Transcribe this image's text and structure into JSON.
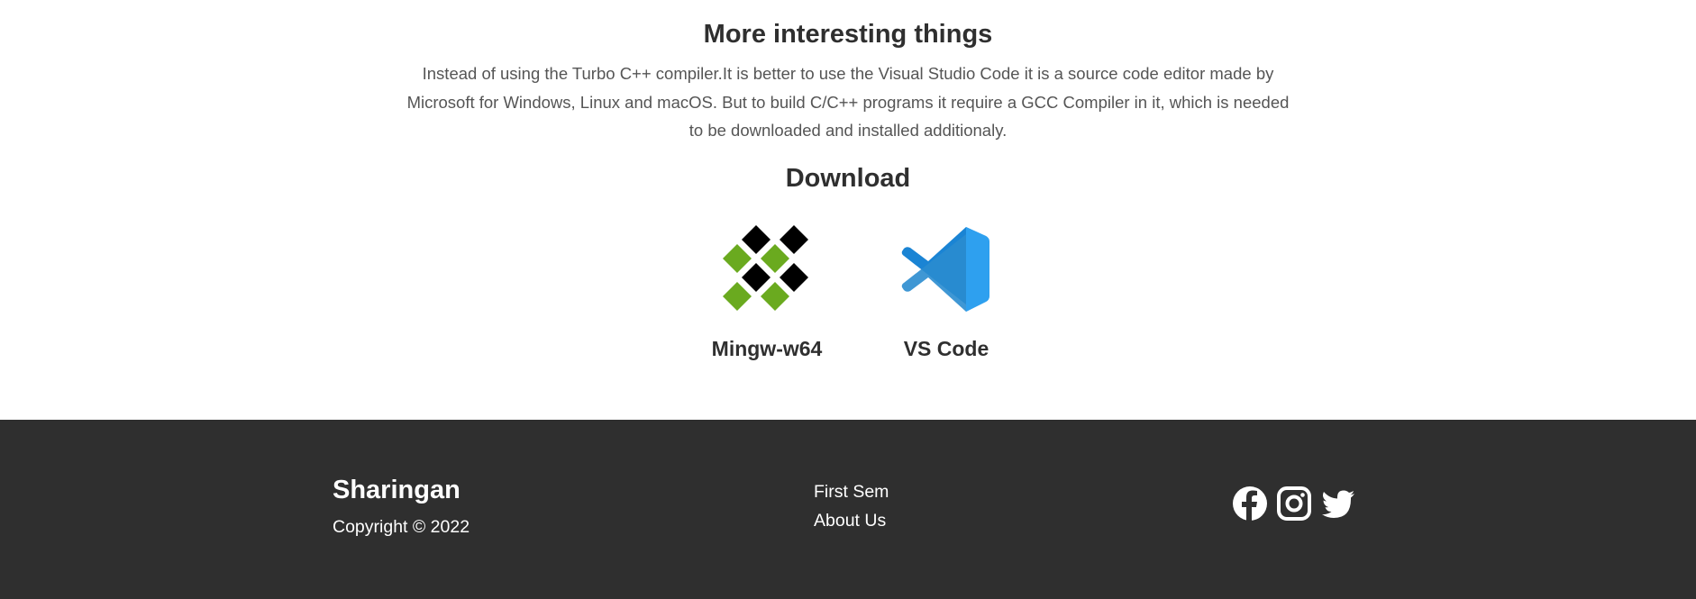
{
  "section": {
    "title": "More interesting things",
    "paragraph": "Instead of using the Turbo C++ compiler.It is better to use the Visual Studio Code it is a source code editor made by Microsoft for Windows, Linux and macOS. But to build C/C++ programs it require a GCC Compiler in it, which is needed to be downloaded and installed additionaly."
  },
  "download": {
    "title": "Download",
    "items": [
      {
        "label": "Mingw-w64",
        "icon": "mingw-logo-icon"
      },
      {
        "label": "VS Code",
        "icon": "vscode-logo-icon"
      }
    ]
  },
  "footer": {
    "brand": "Sharingan",
    "copyright": "Copyright © 2022",
    "links": [
      "First Sem",
      "About Us"
    ],
    "social": [
      "facebook-icon",
      "instagram-icon",
      "twitter-icon"
    ],
    "background": "#2f2f2f"
  },
  "colors": {
    "mingw_green": "#6aaa1f",
    "vscode_blue": "#1f8fe0"
  }
}
